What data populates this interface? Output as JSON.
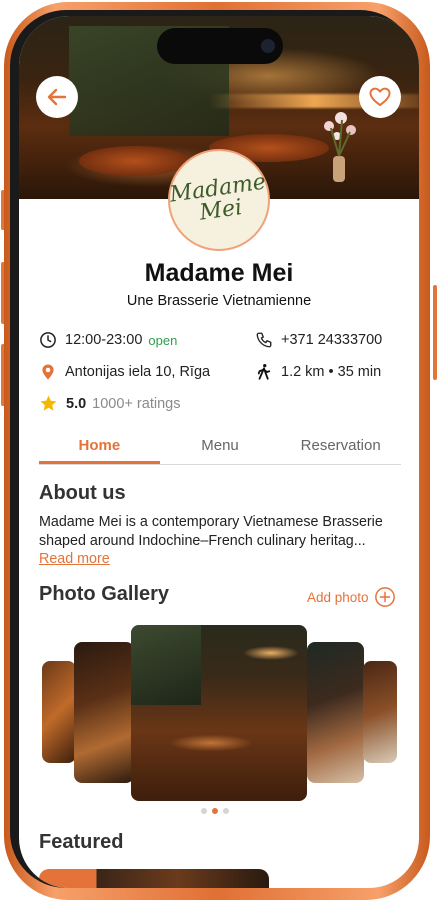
{
  "restaurant": {
    "name": "Madame Mei",
    "tagline": "Une Brasserie Vietnamienne",
    "logo_text_line1": "Madame",
    "logo_text_line2": "Mei"
  },
  "info": {
    "hours": "12:00-23:00",
    "open_status": "open",
    "phone": "+371 24333700",
    "address": "Antonijas iela 10, Rīga",
    "distance": "1.2 km • 35 min",
    "rating": "5.0",
    "ratings_count": "1000+ ratings"
  },
  "tabs": [
    {
      "label": "Home",
      "active": true
    },
    {
      "label": "Menu",
      "active": false
    },
    {
      "label": "Reservation",
      "active": false
    }
  ],
  "about": {
    "title": "About us",
    "text": "Madame Mei is a contemporary Vietnamese Brasserie shaped around Indochine–French culinary heritag...",
    "read_more": "Read more"
  },
  "gallery": {
    "title": "Photo Gallery",
    "add_photo": "Add photo",
    "active_dot": 2,
    "dot_count": 3
  },
  "featured": {
    "title": "Featured"
  },
  "colors": {
    "accent": "#e4733a",
    "open_green": "#2e9e4c",
    "frame": "#e27637"
  },
  "icons": [
    "back-arrow-icon",
    "heart-icon",
    "clock-icon",
    "phone-icon",
    "location-pin-icon",
    "walking-icon",
    "star-icon",
    "plus-circle-icon"
  ]
}
